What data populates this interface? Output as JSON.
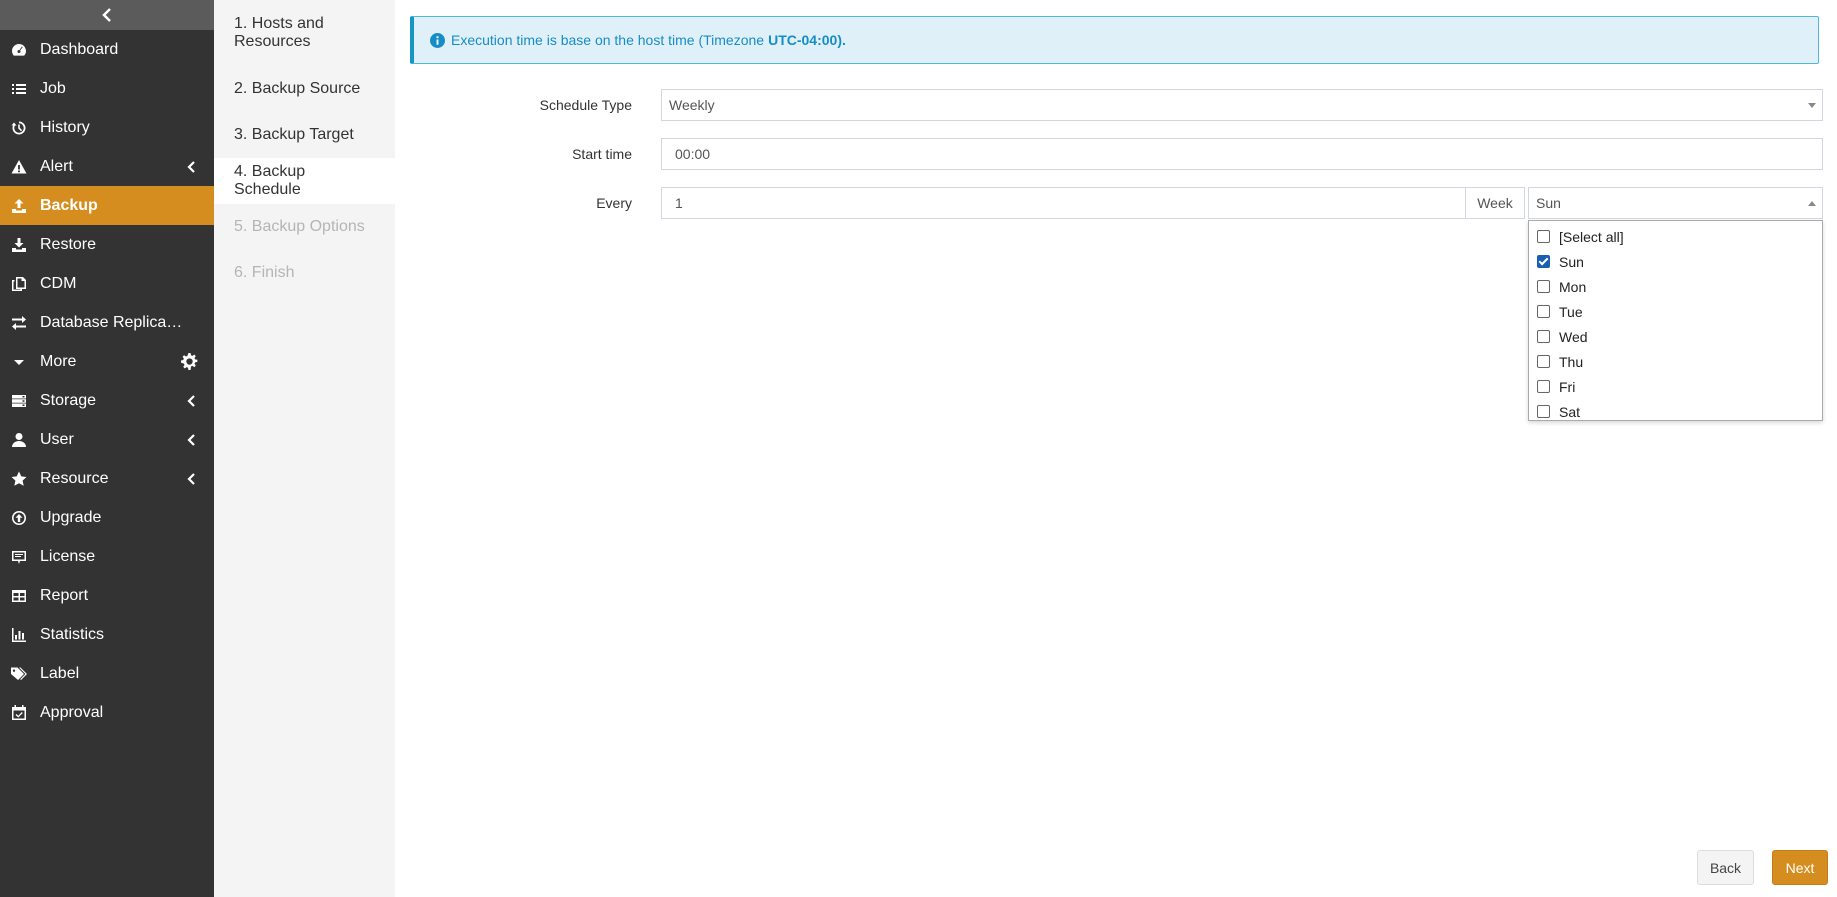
{
  "sidebar": {
    "items": [
      {
        "label": "Dashboard",
        "icon": "dashboard-icon"
      },
      {
        "label": "Job",
        "icon": "list-icon"
      },
      {
        "label": "History",
        "icon": "history-icon"
      },
      {
        "label": "Alert",
        "icon": "warning-icon"
      },
      {
        "label": "Backup",
        "icon": "upload-icon",
        "active": true
      },
      {
        "label": "Restore",
        "icon": "download-icon"
      },
      {
        "label": "CDM",
        "icon": "copy-icon"
      },
      {
        "label": "Database Replica…",
        "icon": "exchange-icon"
      },
      {
        "label": "More",
        "icon": "caret-down-icon"
      },
      {
        "label": "Storage",
        "icon": "storage-icon"
      },
      {
        "label": "User",
        "icon": "user-icon"
      },
      {
        "label": "Resource",
        "icon": "star-icon"
      },
      {
        "label": "Upgrade",
        "icon": "upgrade-icon"
      },
      {
        "label": "License",
        "icon": "license-icon"
      },
      {
        "label": "Report",
        "icon": "table-icon"
      },
      {
        "label": "Statistics",
        "icon": "bar-chart-icon"
      },
      {
        "label": "Label",
        "icon": "tags-icon"
      },
      {
        "label": "Approval",
        "icon": "calendar-check-icon"
      }
    ]
  },
  "steps": [
    {
      "label": "1. Hosts and Resources"
    },
    {
      "label": "2. Backup Source"
    },
    {
      "label": "3. Backup Target"
    },
    {
      "label": "4. Backup Schedule",
      "active": true
    },
    {
      "label": "5. Backup Options",
      "disabled": true
    },
    {
      "label": "6. Finish",
      "disabled": true
    }
  ],
  "alert": {
    "text": "Execution time is base on the host time (Timezone",
    "timezone": "UTC-04:00)."
  },
  "form": {
    "schedule_type_label": "Schedule Type",
    "schedule_type_value": "Weekly",
    "start_time_label": "Start time",
    "start_time_value": "00:00",
    "every_label": "Every",
    "every_value": "1",
    "every_unit": "Week",
    "days_value": "Sun"
  },
  "days_dropdown": [
    {
      "label": "[Select all]",
      "checked": false
    },
    {
      "label": "Sun",
      "checked": true
    },
    {
      "label": "Mon",
      "checked": false
    },
    {
      "label": "Tue",
      "checked": false
    },
    {
      "label": "Wed",
      "checked": false
    },
    {
      "label": "Thu",
      "checked": false
    },
    {
      "label": "Fri",
      "checked": false
    },
    {
      "label": "Sat",
      "checked": false
    }
  ],
  "buttons": {
    "back": "Back",
    "next": "Next"
  }
}
